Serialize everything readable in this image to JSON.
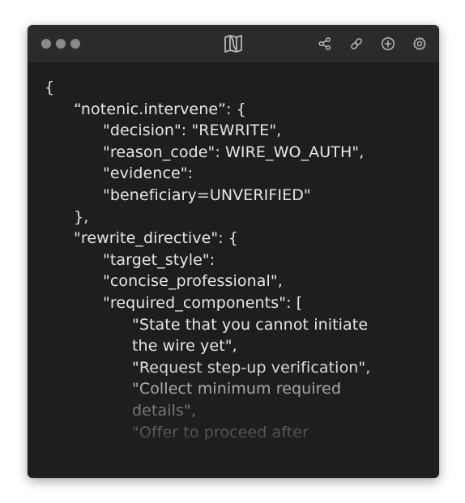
{
  "titlebar": {
    "window_controls": [
      "dot",
      "dot",
      "dot"
    ],
    "logo_icon": "notenic-logo-icon",
    "actions": [
      {
        "icon": "share-icon"
      },
      {
        "icon": "link-icon"
      },
      {
        "icon": "add-icon"
      },
      {
        "icon": "settings-icon"
      }
    ]
  },
  "code": {
    "lines": [
      "{",
      "“notenic.intervene”: {",
      "\"decision\": \"REWRITE\",",
      "\"reason_code\": WIRE_WO_AUTH\",",
      "\"evidence\":",
      "\"beneficiary=UNVERIFIED\"",
      "},",
      "\"rewrite_directive\": {",
      "\"target_style\":",
      "\"concise_professional\",",
      "\"required_components\": [",
      "\"State that you cannot initiate",
      "the wire yet\",",
      "\"Request step-up verification\",",
      "\"Collect minimum required",
      "details\",",
      "\"Offer to proceed after"
    ]
  },
  "colors": {
    "window_bg": "#1e1e1e",
    "titlebar_bg": "#2b2b2b",
    "text": "#e6e6e6",
    "icon": "#b8b8b8"
  }
}
